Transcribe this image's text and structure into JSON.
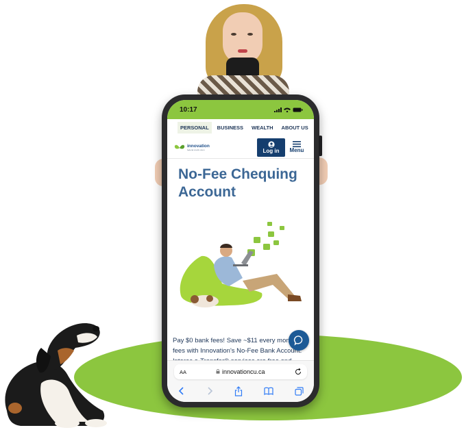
{
  "phone": {
    "status_time": "10:17",
    "nav_tabs": [
      "PERSONAL",
      "BUSINESS",
      "WEALTH",
      "ABOUT US"
    ],
    "active_tab": "PERSONAL",
    "logo_text": "innovation",
    "logo_sub": "federal credit union",
    "login_label": "Log in",
    "menu_label": "Menu",
    "hero_title": "No-Fee Chequing Account",
    "body_text": "Pay $0 bank fees! Save ~$11 every month in fees with Innovation's No-Fee Bank Account. Interac e-Transfer® services are free and",
    "safari": {
      "text_size_label": "AA",
      "url": "innovationcu.ca"
    }
  },
  "colors": {
    "brand_green": "#8cc63f",
    "brand_navy": "#153e6e",
    "title_blue": "#3c6795",
    "chat_blue": "#1c5a96"
  }
}
